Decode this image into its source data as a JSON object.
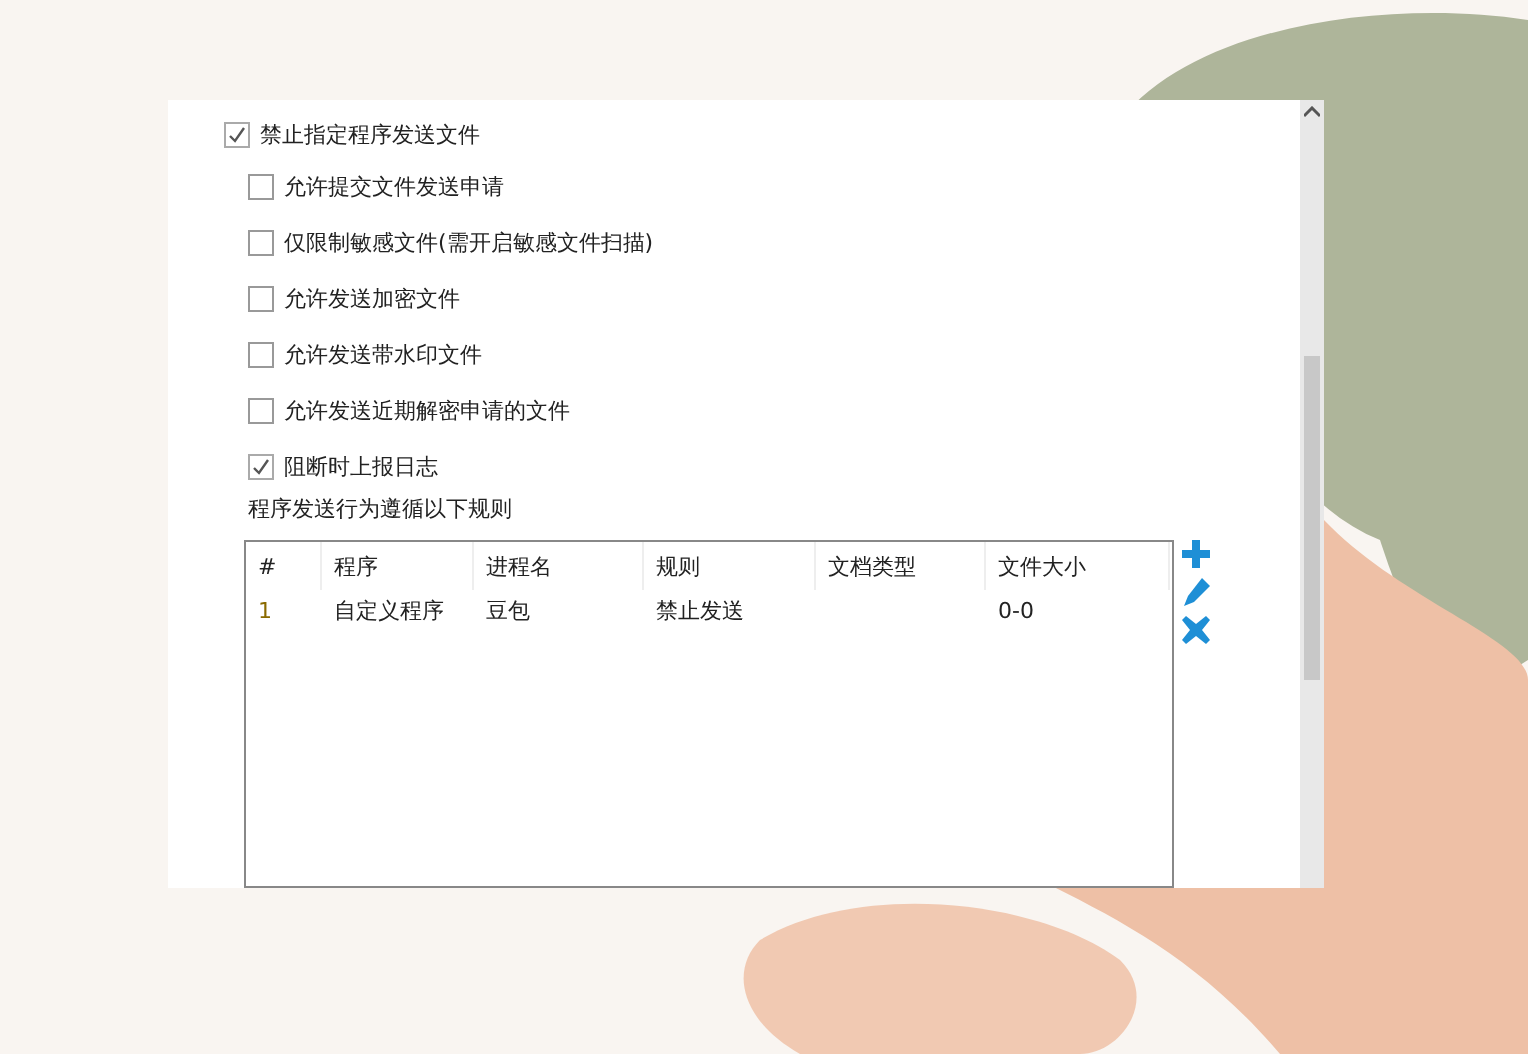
{
  "main_option": {
    "label": "禁止指定程序发送文件",
    "checked": true
  },
  "sub_options": [
    {
      "label": "允许提交文件发送申请",
      "checked": false
    },
    {
      "label": "仅限制敏感文件(需开启敏感文件扫描)",
      "checked": false
    },
    {
      "label": "允许发送加密文件",
      "checked": false
    },
    {
      "label": "允许发送带水印文件",
      "checked": false
    },
    {
      "label": "允许发送近期解密申请的文件",
      "checked": false
    },
    {
      "label": "阻断时上报日志",
      "checked": true
    }
  ],
  "rules_label": "程序发送行为遵循以下规则",
  "table": {
    "columns": [
      "#",
      "程序",
      "进程名",
      "规则",
      "文档类型",
      "文件大小"
    ],
    "rows": [
      [
        "1",
        "自定义程序",
        "豆包",
        "禁止发送",
        "",
        "0-0"
      ]
    ]
  }
}
